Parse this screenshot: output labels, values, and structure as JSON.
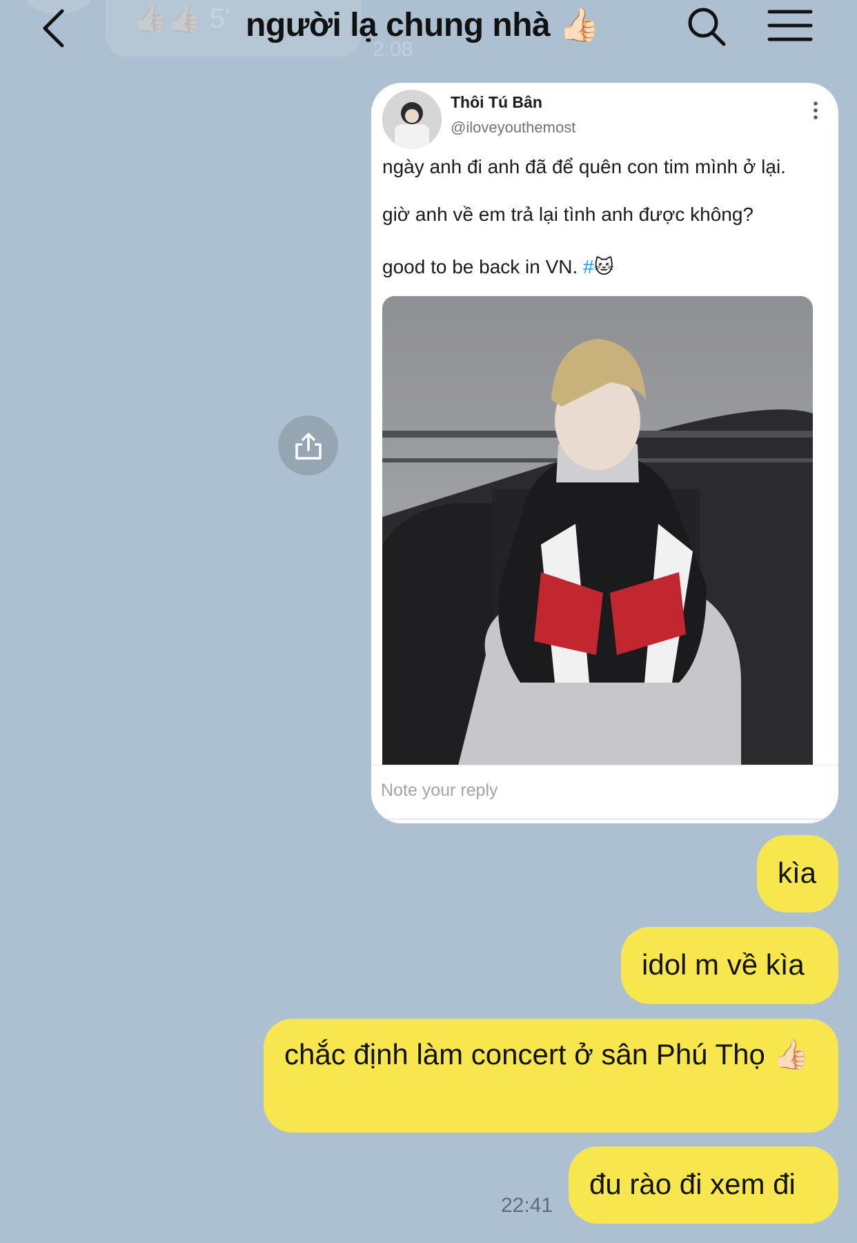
{
  "header": {
    "title": "người lạ chung nhà 👍🏻",
    "ghost_preview_text": "👍🏻👍🏻 5'",
    "ghost_preview_time": "2:08",
    "back_icon": "chevron-left-icon",
    "search_icon": "search-icon",
    "menu_icon": "hamburger-menu-icon"
  },
  "shared_post": {
    "author_name": "Thôi Tú Bân",
    "author_handle": "@iloveyouthemost",
    "line1": "ngày anh đi anh đã để quên con tim mình ở lại.",
    "line2": "giờ anh về em trả lại tình anh được không?",
    "line3_text": "good to be back in VN. ",
    "line3_hashtag": "#",
    "line3_emoji": "🐱",
    "reply_placeholder": "Note your reply"
  },
  "messages": [
    {
      "text": "kìa"
    },
    {
      "text": "idol m về kìa"
    },
    {
      "text": "chắc định làm concert ở sân Phú Thọ 👍🏻"
    },
    {
      "text": "đu rào đi xem đi"
    }
  ],
  "timestamp": "22:41",
  "colors": {
    "background": "#adc0d1",
    "bubble_yellow": "#f8e64f",
    "hashtag_blue": "#1d9bf0"
  }
}
